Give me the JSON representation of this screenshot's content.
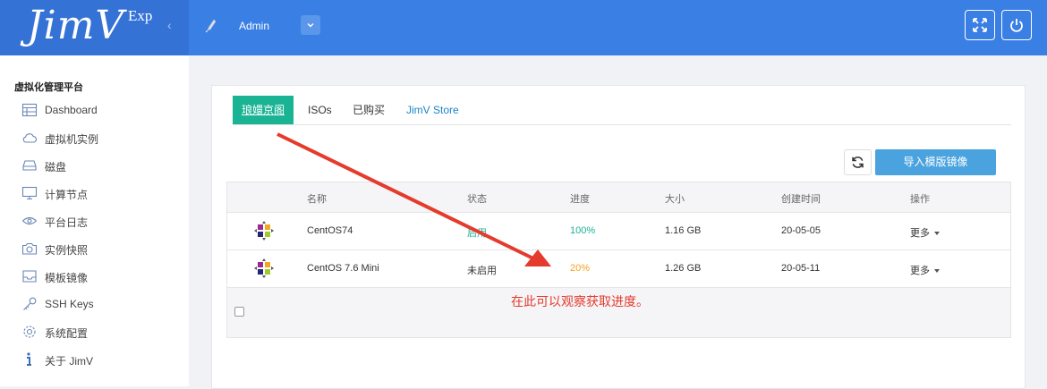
{
  "header": {
    "logo_text": "JimV",
    "logo_sup": "Exp",
    "collapse_glyph": "‹",
    "user_name": "Admin",
    "user_dropdown_glyph": "⌄",
    "fullscreen_icon": "expand-arrows-icon",
    "power_icon": "power-icon",
    "bar_color": "#3a7fe3",
    "logo_bg_color": "#3572d6"
  },
  "sidebar": {
    "title": "虚拟化管理平台",
    "items": [
      {
        "label": "Dashboard",
        "icon": "grid-icon"
      },
      {
        "label": "虚拟机实例",
        "icon": "cloud-icon"
      },
      {
        "label": "磁盘",
        "icon": "disk-icon"
      },
      {
        "label": "计算节点",
        "icon": "monitor-icon"
      },
      {
        "label": "平台日志",
        "icon": "eye-icon"
      },
      {
        "label": "实例快照",
        "icon": "camera-icon"
      },
      {
        "label": "模板镜像",
        "icon": "tray-icon"
      },
      {
        "label": "SSH Keys",
        "icon": "key-icon"
      },
      {
        "label": "系统配置",
        "icon": "gear-icon"
      },
      {
        "label": "关于 JimV",
        "icon": "info-icon"
      }
    ]
  },
  "tabs": [
    {
      "label": "琅嬛京阁",
      "active": true
    },
    {
      "label": "ISOs",
      "active": false
    },
    {
      "label": "已购买",
      "active": false
    },
    {
      "label": "JimV Store",
      "active": false,
      "link": true
    }
  ],
  "toolbar": {
    "refresh_icon": "refresh-icon",
    "import_label": "导入模版镜像",
    "import_color": "#4aa3df"
  },
  "table": {
    "headers": [
      "名称",
      "状态",
      "进度",
      "大小",
      "创建时间",
      "操作"
    ],
    "rows": [
      {
        "icon": "centos-icon",
        "name": "CentOS74",
        "status": "启用",
        "progress": "100%",
        "size": "1.16 GB",
        "created": "20-05-05",
        "action": "更多"
      },
      {
        "icon": "centos-icon",
        "name": "CentOS 7.6 Mini",
        "status": "未启用",
        "progress": "20%",
        "size": "1.26 GB",
        "created": "20-05-11",
        "action": "更多"
      }
    ],
    "progress_colors": {
      "complete": "#1ab394",
      "partial": "#f0a41f"
    },
    "status_color_enabled": "#1ab394"
  },
  "annotation": {
    "text": "在此可以观察获取进度。",
    "color": "#e53b2c"
  }
}
